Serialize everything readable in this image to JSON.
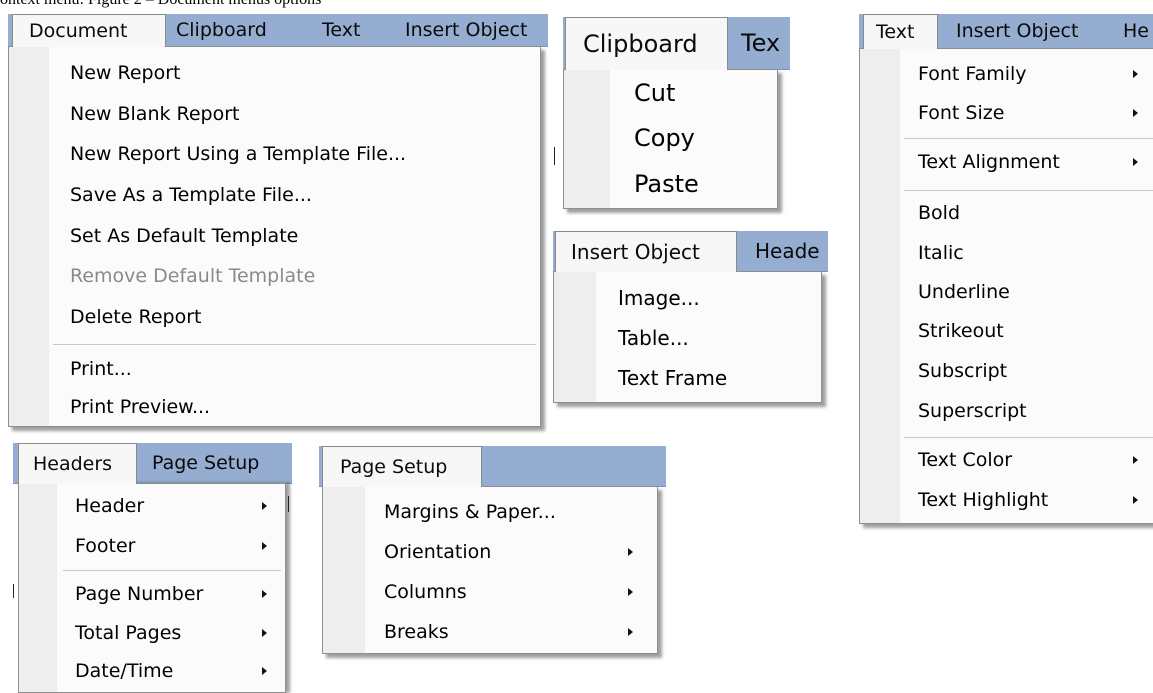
{
  "caption": "ontext menu: Figure 2 – Document menus options",
  "tab_bar_color": "#94add0",
  "document_menu": {
    "tabs": [
      "Document",
      "Clipboard",
      "Text",
      "Insert Object"
    ],
    "items": [
      "New Report",
      "New Blank Report",
      "New Report Using a Template File...",
      "Save As a Template File...",
      "Set As Default Template",
      "Remove Default Template",
      "Delete Report",
      "Print...",
      "Print Preview..."
    ],
    "disabled_item": "Remove Default Template"
  },
  "clipboard_menu": {
    "tabs": [
      "Clipboard",
      "Tex"
    ],
    "items": [
      "Cut",
      "Copy",
      "Paste"
    ]
  },
  "insert_object_menu": {
    "tabs": [
      "Insert Object",
      "Heade"
    ],
    "items": [
      "Image...",
      "Table...",
      "Text Frame"
    ]
  },
  "text_menu": {
    "tabs": [
      "Text",
      "Insert Object",
      "He"
    ],
    "items": [
      "Font Family",
      "Font Size",
      "Text Alignment",
      "Bold",
      "Italic",
      "Underline",
      "Strikeout",
      "Subscript",
      "Superscript",
      "Text Color",
      "Text Highlight"
    ],
    "submenu_icon": "chevron-right-icon"
  },
  "headers_menu": {
    "tabs": [
      "Headers",
      "Page Setup"
    ],
    "items": [
      "Header",
      "Footer",
      "Page Number",
      "Total Pages",
      "Date/Time"
    ],
    "submenu_icon": "chevron-right-icon"
  },
  "page_setup_menu": {
    "tabs": [
      "Page Setup"
    ],
    "items": [
      "Margins & Paper...",
      "Orientation",
      "Columns",
      "Breaks"
    ],
    "submenu_icon": "chevron-right-icon"
  }
}
